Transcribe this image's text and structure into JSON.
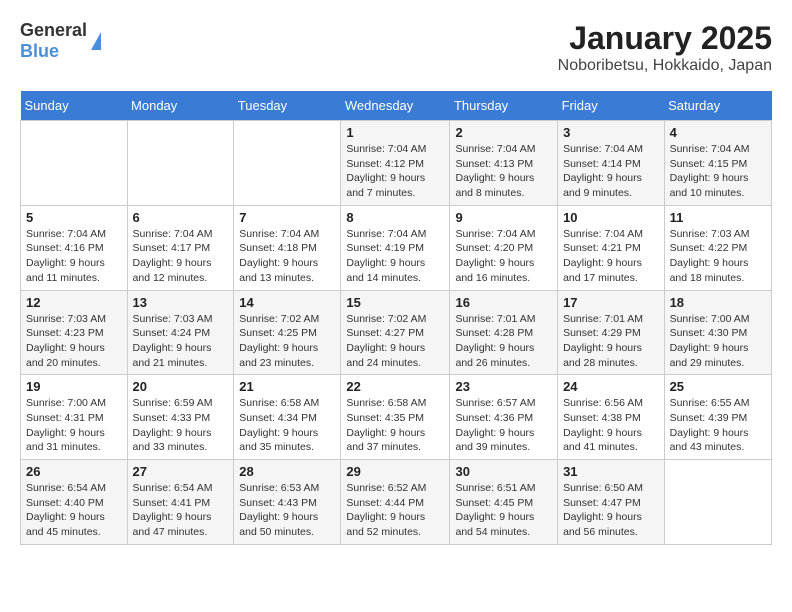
{
  "logo": {
    "general": "General",
    "blue": "Blue"
  },
  "title": "January 2025",
  "subtitle": "Noboribetsu, Hokkaido, Japan",
  "days_of_week": [
    "Sunday",
    "Monday",
    "Tuesday",
    "Wednesday",
    "Thursday",
    "Friday",
    "Saturday"
  ],
  "weeks": [
    [
      {
        "day": "",
        "info": ""
      },
      {
        "day": "",
        "info": ""
      },
      {
        "day": "",
        "info": ""
      },
      {
        "day": "1",
        "info": "Sunrise: 7:04 AM\nSunset: 4:12 PM\nDaylight: 9 hours and 7 minutes."
      },
      {
        "day": "2",
        "info": "Sunrise: 7:04 AM\nSunset: 4:13 PM\nDaylight: 9 hours and 8 minutes."
      },
      {
        "day": "3",
        "info": "Sunrise: 7:04 AM\nSunset: 4:14 PM\nDaylight: 9 hours and 9 minutes."
      },
      {
        "day": "4",
        "info": "Sunrise: 7:04 AM\nSunset: 4:15 PM\nDaylight: 9 hours and 10 minutes."
      }
    ],
    [
      {
        "day": "5",
        "info": "Sunrise: 7:04 AM\nSunset: 4:16 PM\nDaylight: 9 hours and 11 minutes."
      },
      {
        "day": "6",
        "info": "Sunrise: 7:04 AM\nSunset: 4:17 PM\nDaylight: 9 hours and 12 minutes."
      },
      {
        "day": "7",
        "info": "Sunrise: 7:04 AM\nSunset: 4:18 PM\nDaylight: 9 hours and 13 minutes."
      },
      {
        "day": "8",
        "info": "Sunrise: 7:04 AM\nSunset: 4:19 PM\nDaylight: 9 hours and 14 minutes."
      },
      {
        "day": "9",
        "info": "Sunrise: 7:04 AM\nSunset: 4:20 PM\nDaylight: 9 hours and 16 minutes."
      },
      {
        "day": "10",
        "info": "Sunrise: 7:04 AM\nSunset: 4:21 PM\nDaylight: 9 hours and 17 minutes."
      },
      {
        "day": "11",
        "info": "Sunrise: 7:03 AM\nSunset: 4:22 PM\nDaylight: 9 hours and 18 minutes."
      }
    ],
    [
      {
        "day": "12",
        "info": "Sunrise: 7:03 AM\nSunset: 4:23 PM\nDaylight: 9 hours and 20 minutes."
      },
      {
        "day": "13",
        "info": "Sunrise: 7:03 AM\nSunset: 4:24 PM\nDaylight: 9 hours and 21 minutes."
      },
      {
        "day": "14",
        "info": "Sunrise: 7:02 AM\nSunset: 4:25 PM\nDaylight: 9 hours and 23 minutes."
      },
      {
        "day": "15",
        "info": "Sunrise: 7:02 AM\nSunset: 4:27 PM\nDaylight: 9 hours and 24 minutes."
      },
      {
        "day": "16",
        "info": "Sunrise: 7:01 AM\nSunset: 4:28 PM\nDaylight: 9 hours and 26 minutes."
      },
      {
        "day": "17",
        "info": "Sunrise: 7:01 AM\nSunset: 4:29 PM\nDaylight: 9 hours and 28 minutes."
      },
      {
        "day": "18",
        "info": "Sunrise: 7:00 AM\nSunset: 4:30 PM\nDaylight: 9 hours and 29 minutes."
      }
    ],
    [
      {
        "day": "19",
        "info": "Sunrise: 7:00 AM\nSunset: 4:31 PM\nDaylight: 9 hours and 31 minutes."
      },
      {
        "day": "20",
        "info": "Sunrise: 6:59 AM\nSunset: 4:33 PM\nDaylight: 9 hours and 33 minutes."
      },
      {
        "day": "21",
        "info": "Sunrise: 6:58 AM\nSunset: 4:34 PM\nDaylight: 9 hours and 35 minutes."
      },
      {
        "day": "22",
        "info": "Sunrise: 6:58 AM\nSunset: 4:35 PM\nDaylight: 9 hours and 37 minutes."
      },
      {
        "day": "23",
        "info": "Sunrise: 6:57 AM\nSunset: 4:36 PM\nDaylight: 9 hours and 39 minutes."
      },
      {
        "day": "24",
        "info": "Sunrise: 6:56 AM\nSunset: 4:38 PM\nDaylight: 9 hours and 41 minutes."
      },
      {
        "day": "25",
        "info": "Sunrise: 6:55 AM\nSunset: 4:39 PM\nDaylight: 9 hours and 43 minutes."
      }
    ],
    [
      {
        "day": "26",
        "info": "Sunrise: 6:54 AM\nSunset: 4:40 PM\nDaylight: 9 hours and 45 minutes."
      },
      {
        "day": "27",
        "info": "Sunrise: 6:54 AM\nSunset: 4:41 PM\nDaylight: 9 hours and 47 minutes."
      },
      {
        "day": "28",
        "info": "Sunrise: 6:53 AM\nSunset: 4:43 PM\nDaylight: 9 hours and 50 minutes."
      },
      {
        "day": "29",
        "info": "Sunrise: 6:52 AM\nSunset: 4:44 PM\nDaylight: 9 hours and 52 minutes."
      },
      {
        "day": "30",
        "info": "Sunrise: 6:51 AM\nSunset: 4:45 PM\nDaylight: 9 hours and 54 minutes."
      },
      {
        "day": "31",
        "info": "Sunrise: 6:50 AM\nSunset: 4:47 PM\nDaylight: 9 hours and 56 minutes."
      },
      {
        "day": "",
        "info": ""
      }
    ]
  ]
}
